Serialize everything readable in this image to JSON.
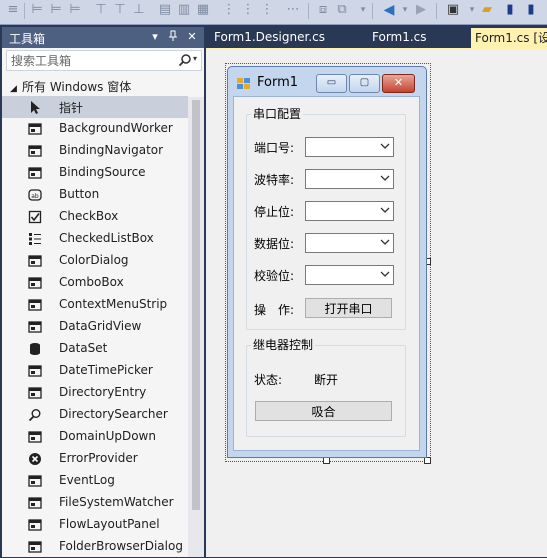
{
  "toolbox": {
    "title": "工具箱",
    "pin_glyph": "▾",
    "autohide_glyph": "ꟾ",
    "close_glyph": "✕",
    "search_placeholder": "搜索工具箱",
    "group_label": "所有 Windows 窗体",
    "items": [
      {
        "label": "指针",
        "icon": "pointer-icon",
        "selected": true
      },
      {
        "label": "BackgroundWorker",
        "icon": "background-worker-icon"
      },
      {
        "label": "BindingNavigator",
        "icon": "binding-navigator-icon"
      },
      {
        "label": "BindingSource",
        "icon": "binding-source-icon"
      },
      {
        "label": "Button",
        "icon": "button-icon"
      },
      {
        "label": "CheckBox",
        "icon": "checkbox-icon"
      },
      {
        "label": "CheckedListBox",
        "icon": "checked-listbox-icon"
      },
      {
        "label": "ColorDialog",
        "icon": "color-dialog-icon"
      },
      {
        "label": "ComboBox",
        "icon": "combobox-icon"
      },
      {
        "label": "ContextMenuStrip",
        "icon": "context-menu-strip-icon"
      },
      {
        "label": "DataGridView",
        "icon": "data-grid-view-icon"
      },
      {
        "label": "DataSet",
        "icon": "dataset-icon"
      },
      {
        "label": "DateTimePicker",
        "icon": "date-time-picker-icon"
      },
      {
        "label": "DirectoryEntry",
        "icon": "directory-entry-icon"
      },
      {
        "label": "DirectorySearcher",
        "icon": "directory-searcher-icon"
      },
      {
        "label": "DomainUpDown",
        "icon": "domain-up-down-icon"
      },
      {
        "label": "ErrorProvider",
        "icon": "error-provider-icon"
      },
      {
        "label": "EventLog",
        "icon": "event-log-icon"
      },
      {
        "label": "FileSystemWatcher",
        "icon": "file-system-watcher-icon"
      },
      {
        "label": "FlowLayoutPanel",
        "icon": "flow-layout-panel-icon"
      },
      {
        "label": "FolderBrowserDialog",
        "icon": "folder-browser-dialog-icon"
      }
    ]
  },
  "tabs": [
    {
      "label": "Form1.Designer.cs",
      "active": false
    },
    {
      "label": "Form1.cs",
      "active": false
    },
    {
      "label": "Form1.cs [设",
      "active": true
    }
  ],
  "form": {
    "title": "Form1",
    "minimize_glyph": "▭",
    "maximize_glyph": "▢",
    "close_glyph": "✕",
    "serial_group": {
      "caption": "串口配置",
      "fields": [
        {
          "label": "端口号:",
          "value": ""
        },
        {
          "label": "波特率:",
          "value": ""
        },
        {
          "label": "停止位:",
          "value": ""
        },
        {
          "label": "数据位:",
          "value": ""
        },
        {
          "label": "校验位:",
          "value": ""
        }
      ],
      "operate_label": "操　作:",
      "open_button": "打开串口"
    },
    "relay_group": {
      "caption": "继电器控制",
      "status_label": "状态:",
      "status_value": "断开",
      "close_button": "吸合"
    }
  },
  "colors": {
    "ide_background": "#293955",
    "toolbox_title": "#4d6082",
    "active_tab": "#fff1b0",
    "form_frame": "#c4d6ee",
    "close_button": "#c5432f"
  }
}
